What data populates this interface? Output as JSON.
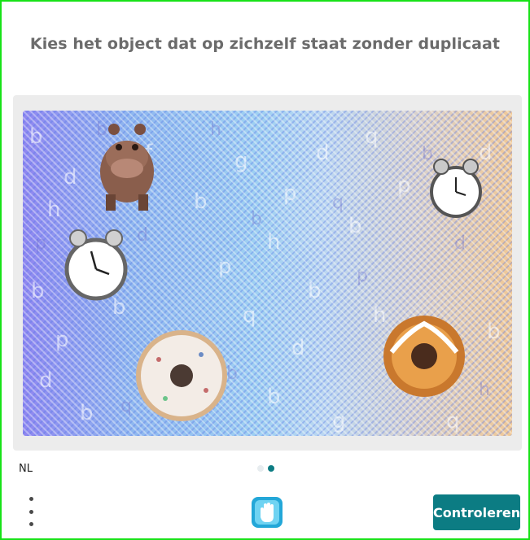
{
  "prompt": {
    "text": "Kies het object dat op zichzelf staat zonder duplicaat"
  },
  "footer": {
    "language": "NL",
    "submit_label": "Controleren",
    "page_indicator": {
      "total": 2,
      "current": 2
    }
  },
  "icons": {
    "menu": "more-vertical-icon",
    "logo": "hand-logo-icon"
  },
  "colors": {
    "accent": "#0c7c83",
    "border": "#17e217",
    "title": "#6b6b6b"
  }
}
